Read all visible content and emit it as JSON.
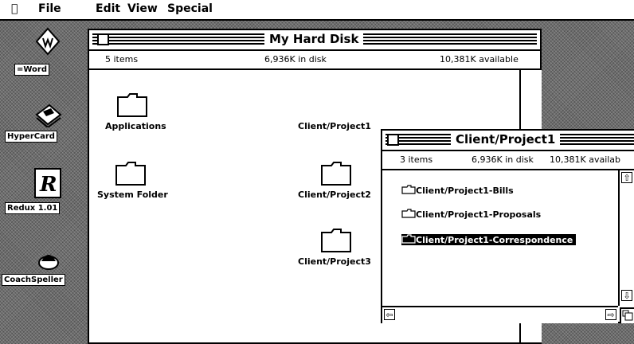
{
  "menubar": {
    "apple": "",
    "items": [
      "File",
      "Edit",
      "View",
      "Special"
    ]
  },
  "desktop_icons": [
    {
      "label": "=Word",
      "icon": "word-icon"
    },
    {
      "label": "HyperCard",
      "icon": "hypercard-icon"
    },
    {
      "label": "Redux 1.01",
      "icon": "redux-icon"
    },
    {
      "label": "CoachSpeller",
      "icon": "coachspeller-icon"
    }
  ],
  "hard_disk_window": {
    "title": "My Hard Disk",
    "items_count": "5 items",
    "in_disk": "6,936K in disk",
    "available": "10,381K available",
    "items": [
      {
        "label": "Applications",
        "icon": "folder-icon"
      },
      {
        "label": "Client/Project1",
        "icon": "folder-icon"
      },
      {
        "label": "System Folder",
        "icon": "folder-icon"
      },
      {
        "label": "Client/Project2",
        "icon": "folder-icon"
      },
      {
        "label": "Client/Project3",
        "icon": "folder-icon"
      }
    ]
  },
  "project_window": {
    "title": "Client/Project1",
    "items_count": "3 items",
    "in_disk": "6,936K in disk",
    "available": "10,381K availab",
    "list": [
      {
        "label": "Client/Project1-Bills",
        "selected": false
      },
      {
        "label": "Client/Project1-Proposals",
        "selected": false
      },
      {
        "label": "Client/Project1-Correspondence",
        "selected": true
      }
    ]
  }
}
